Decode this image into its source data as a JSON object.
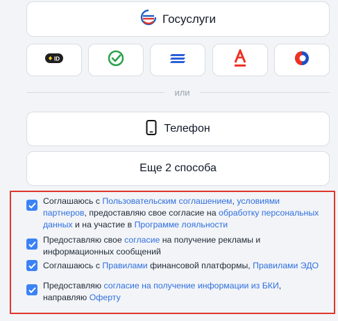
{
  "gosuslugi": {
    "label": "Госуслуги"
  },
  "alt_login_tiles": [
    {
      "icon": "sber-id-icon"
    },
    {
      "icon": "checkmark-circle-icon"
    },
    {
      "icon": "tinkoff-stripes-icon"
    },
    {
      "icon": "alfa-bank-icon"
    },
    {
      "icon": "brand-circle-icon"
    }
  ],
  "divider": {
    "label": "или"
  },
  "phone": {
    "label": "Телефон"
  },
  "more": {
    "label": "Еще 2 способа"
  },
  "consents": [
    {
      "parts": [
        {
          "t": "Соглашаюсь с "
        },
        {
          "t": "Пользовательским соглашением",
          "link": true
        },
        {
          "t": ", "
        },
        {
          "t": "условиями партнеров",
          "link": true
        },
        {
          "t": ", предоставляю свое согласие на "
        },
        {
          "t": "обработку персональных данных",
          "link": true
        },
        {
          "t": " и на участие в "
        },
        {
          "t": "Программе лояльности",
          "link": true
        }
      ]
    },
    {
      "parts": [
        {
          "t": "Предоставляю свое "
        },
        {
          "t": "согласие",
          "link": true
        },
        {
          "t": " на получение рекламы и информационных сообщений"
        }
      ]
    },
    {
      "parts": [
        {
          "t": "Соглашаюсь с "
        },
        {
          "t": "Правилами",
          "link": true
        },
        {
          "t": " финансовой платформы, "
        },
        {
          "t": "Правилами ЭДО",
          "link": true
        }
      ]
    },
    {
      "parts": [
        {
          "t": "Предоставляю "
        },
        {
          "t": "согласие на получение информации из БКИ",
          "link": true
        },
        {
          "t": ", направляю "
        },
        {
          "t": "Оферту",
          "link": true
        }
      ]
    }
  ],
  "colors": {
    "accent": "#2f6fe0",
    "checkbox": "#3b82f6",
    "highlight": "#e0352b"
  }
}
